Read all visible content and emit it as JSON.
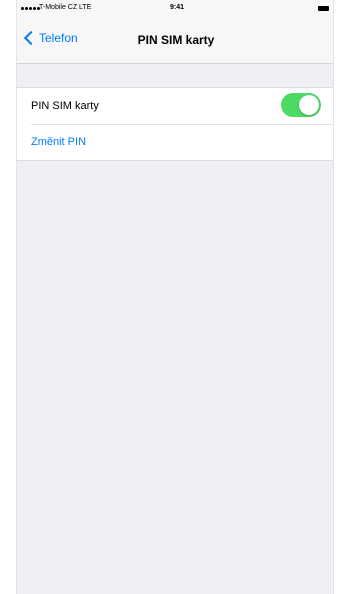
{
  "status_bar": {
    "carrier": "T-Mobile CZ  LTE",
    "time": "9:41"
  },
  "nav": {
    "back_label": "Telefon",
    "title": "PIN SIM karty"
  },
  "settings": {
    "pin_row_label": "PIN SIM karty",
    "pin_toggle_on": true,
    "change_pin_label": "Změnit PIN"
  },
  "colors": {
    "accent": "#007aff",
    "toggle_on": "#4cd964",
    "carrier_tab": "#e20074",
    "background": "#efeff4"
  },
  "icons": {
    "back": "chevron-left-icon",
    "signal": "signal-dots-icon",
    "battery": "battery-icon"
  }
}
